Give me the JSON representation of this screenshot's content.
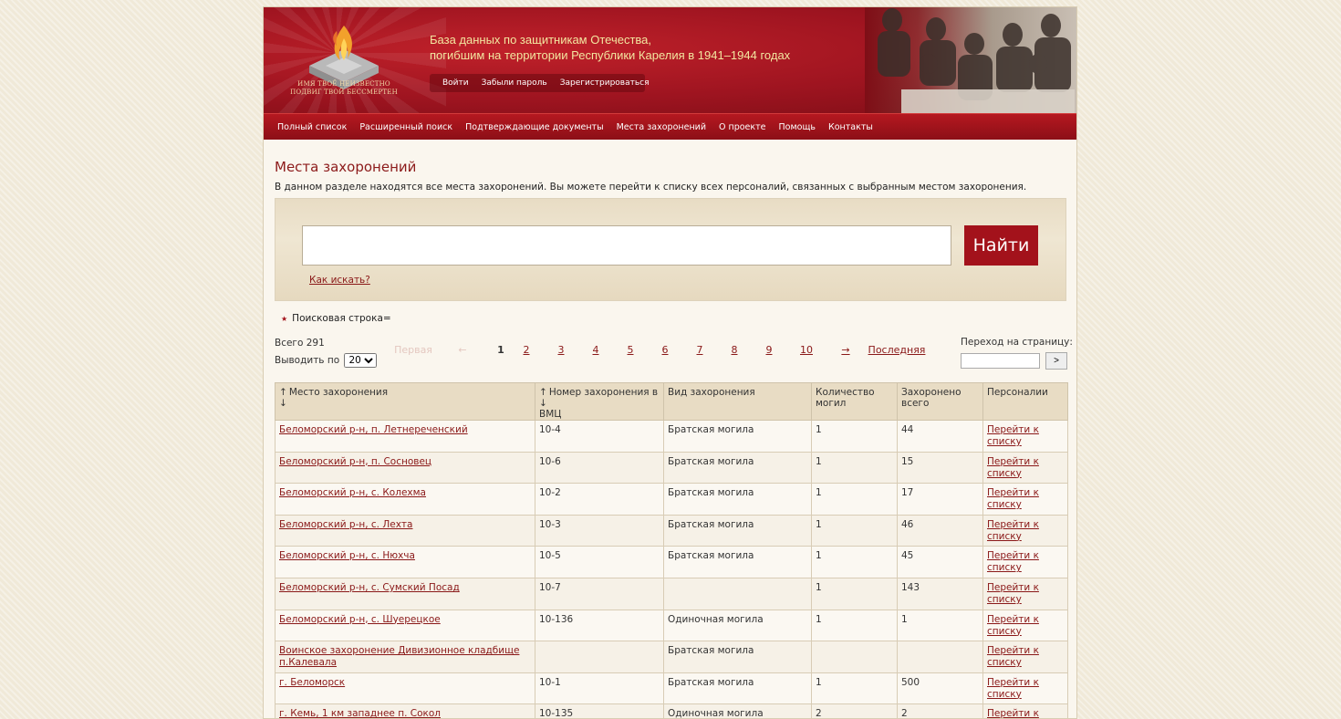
{
  "header": {
    "logo_text_1": "ИМЯ ТВОЁ НЕИЗВЕСТНО",
    "logo_text_2": "ПОДВИГ ТВОЙ БЕССМЕРТЕН",
    "title_line1": "База данных по защитникам Отечества,",
    "title_line2": "погибшим на территории Республики Карелия в 1941–1944 годах",
    "auth": [
      "Войти",
      "Забыли пароль",
      "Зарегистрироваться"
    ]
  },
  "nav": [
    "Полный список",
    "Расширенный поиск",
    "Подтверждающие документы",
    "Места захоронений",
    "О проекте",
    "Помощь",
    "Контакты"
  ],
  "main": {
    "heading": "Места захоронений",
    "intro": "В данном разделе находятся все места захоронений. Вы можете перейти к списку всех персоналий, связанных с выбранным местом захоронения.",
    "search_button": "Найти",
    "search_value": "",
    "howto": "Как искать?",
    "query_line": "Поисковая строка="
  },
  "pager": {
    "total": "Всего 291",
    "per_page_label": "Выводить по",
    "per_page_value": "20",
    "first": "Первая",
    "prev": "←",
    "pages": [
      "1",
      "2",
      "3",
      "4",
      "5",
      "6",
      "7",
      "8",
      "9",
      "10"
    ],
    "next": "→",
    "last": "Последняя",
    "goto_label": "Переход на страницу:",
    "goto_button": ">"
  },
  "table": {
    "columns": [
      "Место захоронения",
      "Номер захоронения в ВМЦ",
      "Вид захоронения",
      "Количество могил",
      "Захоронено всего",
      "Персоналии"
    ],
    "sort_arrows": "↑↓",
    "link_text": "Перейти к списку",
    "rows": [
      [
        "Беломорский р-н, п. Летнереченский",
        "10-4",
        "Братская могила",
        "1",
        "44"
      ],
      [
        "Беломорский р-н, п. Сосновец",
        "10-6",
        "Братская могила",
        "1",
        "15"
      ],
      [
        "Беломорский р-н, с. Колехма",
        "10-2",
        "Братская могила",
        "1",
        "17"
      ],
      [
        "Беломорский р-н, с. Лехта",
        "10-3",
        "Братская могила",
        "1",
        "46"
      ],
      [
        "Беломорский р-н, с. Нюхча",
        "10-5",
        "Братская могила",
        "1",
        "45"
      ],
      [
        "Беломорский р-н, с. Сумский Посад",
        "10-7",
        "",
        "1",
        "143"
      ],
      [
        "Беломорский р-н, с. Шуерецкое",
        "10-136",
        "Одиночная могила",
        "1",
        "1"
      ],
      [
        "Воинское захоронение Дивизионное кладбище п.Калевала",
        "",
        "Братская могила",
        "",
        ""
      ],
      [
        "г. Беломорск",
        "10-1",
        "Братская могила",
        "1",
        "500"
      ],
      [
        "г. Кемь, 1 км западнее п. Сокол",
        "10-135",
        "Одиночная могила",
        "2",
        "2"
      ]
    ]
  }
}
